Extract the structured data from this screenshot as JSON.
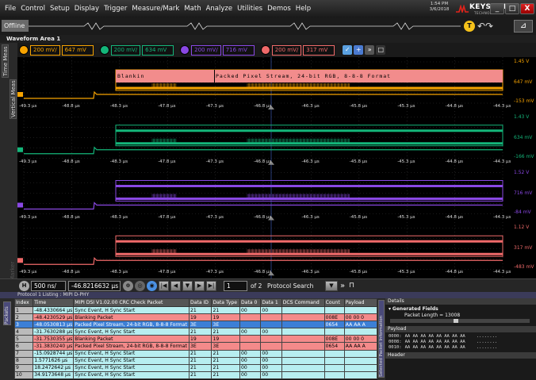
{
  "menu": [
    "File",
    "Control",
    "Setup",
    "Display",
    "Trigger",
    "Measure/Mark",
    "Math",
    "Analyze",
    "Utilities",
    "Demos",
    "Help"
  ],
  "clock": {
    "time": "1:54 PM",
    "date": "3/6/2018"
  },
  "brand": {
    "name": "KEYSIGHT",
    "sub": "TECHNOLOGIES"
  },
  "window": {
    "minimize": "_",
    "restore": "□",
    "close": "X"
  },
  "toolbar": {
    "offline": "Offline",
    "status_badge": "T"
  },
  "waveform_area": {
    "title": "Waveform Area 1"
  },
  "tabs": {
    "time_meas": "Time Meas",
    "vertical_meas": "Vertical Meas",
    "marker": "Marker"
  },
  "channels": [
    {
      "scale": "200 mV/",
      "offset": "647 mV",
      "color": "#f7a300"
    },
    {
      "scale": "200 mV/",
      "offset": "634 mV",
      "color": "#14b67a"
    },
    {
      "scale": "200 mV/",
      "offset": "716 mV",
      "color": "#8a48e4"
    },
    {
      "scale": "200 mV/",
      "offset": "317 mV",
      "color": "#f06a6a"
    }
  ],
  "strip_icons": {
    "box1": "✓",
    "box2": "+",
    "box3": "»",
    "box4": "□"
  },
  "trace_labels": {
    "blanking": "Blankin",
    "pps": "Packed Pixel Stream, 24-bit RGB, 8-8-8 Format"
  },
  "right_scales": [
    {
      "top": "1.45 V",
      "mid": "647 mV",
      "bottom": "-153 mV"
    },
    {
      "top": "1.43 V",
      "mid": "634 mV",
      "bottom": "-166 mV"
    },
    {
      "top": "1.52 V",
      "mid": "716 mV",
      "bottom": "-84 mV"
    },
    {
      "top": "1.12 V",
      "mid": "317 mV",
      "bottom": "-483 mV"
    }
  ],
  "time_ticks": [
    "-49.3 µs",
    "-48.8 µs",
    "-48.3 µs",
    "-47.8 µs",
    "-47.3 µs",
    "-46.8 µs",
    "-46.3 µs",
    "-45.8 µs",
    "-45.3 µs",
    "-44.8 µs",
    "-44.3 µs"
  ],
  "trig_markers": [
    "T",
    "T",
    "T",
    "T"
  ],
  "nav": {
    "h_icon": "H",
    "timebase": "500 ns/",
    "position": "-46.8216632 µs",
    "page": "1",
    "of_pages": "of 2",
    "search": "Protocol Search",
    "search_arrow": "▼",
    "go": "»",
    "btn_first": "|◀",
    "btn_prev": "◀",
    "btn_down": "▼",
    "btn_next": "▶",
    "btn_last": "▶|"
  },
  "listing": {
    "title": "Protocol 1 Listing : MIPI D-PHY",
    "side_tab": "Packets",
    "columns": [
      "Index",
      "Time",
      "MIPI DSI V1.02.00 CRC Check Packet",
      "Data ID",
      "Data Type",
      "Data 0",
      "Data 1",
      "DCS Command",
      "Count",
      "Payload"
    ],
    "rows": [
      {
        "kind": "sync",
        "cells": [
          "1",
          "-48.4330664 µs",
          "Sync Event, H Sync Start",
          "21",
          "21",
          "00",
          "00",
          "",
          "",
          ""
        ]
      },
      {
        "kind": "blank",
        "cells": [
          "2",
          "-48.4230529 µs",
          "Blanking Packet",
          "19",
          "19",
          "",
          "",
          "",
          "008E",
          "00 00 0"
        ]
      },
      {
        "kind": "sel",
        "cells": [
          "3",
          "-48.0530813 µs",
          "Packed Pixel Stream, 24-bit RGB, 8-8-8 Format",
          "3E",
          "3E",
          "",
          "",
          "",
          "0654",
          "AA AA A"
        ]
      },
      {
        "kind": "sync",
        "cells": [
          "4",
          "-31.7630288 µs",
          "Sync Event, H Sync Start",
          "21",
          "21",
          "00",
          "00",
          "",
          "",
          ""
        ]
      },
      {
        "kind": "blank",
        "cells": [
          "5",
          "-31.7530355 µs",
          "Blanking Packet",
          "19",
          "19",
          "",
          "",
          "",
          "008E",
          "00 00 0"
        ]
      },
      {
        "kind": "pps",
        "cells": [
          "6",
          "-31.3830240 µs",
          "Packed Pixel Stream, 24-bit RGB, 8-8-8 Format",
          "3E",
          "3E",
          "",
          "",
          "",
          "0654",
          "AA AA A"
        ]
      },
      {
        "kind": "sync",
        "cells": [
          "7",
          "-15.0928744 µs",
          "Sync Event, H Sync Start",
          "21",
          "21",
          "00",
          "00",
          "",
          "",
          ""
        ]
      },
      {
        "kind": "sync",
        "cells": [
          "8",
          "1.5771626 µs",
          "Sync Event, H Sync Start",
          "21",
          "21",
          "00",
          "00",
          "",
          "",
          ""
        ]
      },
      {
        "kind": "sync",
        "cells": [
          "9",
          "18.2472642 µs",
          "Sync Event, H Sync Start",
          "21",
          "21",
          "00",
          "00",
          "",
          "",
          ""
        ]
      },
      {
        "kind": "sync",
        "cells": [
          "10",
          "34.9173648 µs",
          "Sync Event, H Sync Start",
          "21",
          "21",
          "00",
          "00",
          "",
          "",
          ""
        ]
      }
    ]
  },
  "details": {
    "side_tab": "Selected Packet Information",
    "header": "Details",
    "generated": "Generated Fields",
    "packet_length": "Packet Length = 13008",
    "payload_header": "Payload",
    "hex_rows": [
      {
        "addr": "0000:",
        "bytes": "AA AA AA AA AA AA AA AA",
        "ascii": "........"
      },
      {
        "addr": "0008:",
        "bytes": "AA AA AA AA AA AA AA AA",
        "ascii": "........"
      },
      {
        "addr": "0010:",
        "bytes": "AA AA AA AA AA AA AA AA",
        "ascii": "........"
      }
    ],
    "header_section": "Header"
  }
}
